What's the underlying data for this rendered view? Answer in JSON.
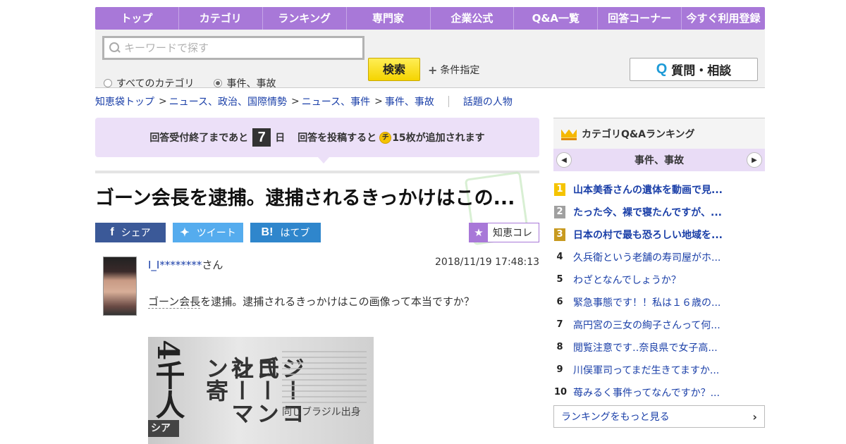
{
  "nav": [
    "トップ",
    "カテゴリ",
    "ランキング",
    "専門家",
    "企業公式",
    "Q&A一覧",
    "回答コーナー",
    "今すぐ利用登録"
  ],
  "search": {
    "placeholder": "キーワードで探す",
    "button": "検索",
    "conditions": "条件指定",
    "ask_button": "質問・相談",
    "ask_icon": "Q",
    "radio_all": "すべてのカテゴリ",
    "radio_current": "事件、事故"
  },
  "breadcrumb": {
    "items": [
      "知恵袋トップ",
      "ニュース、政治、国際情勢",
      "ニュース、事件",
      "事件、事故"
    ],
    "sep": ">",
    "related": "話題の人物"
  },
  "notice": {
    "prefix": "回答受付終了まであと",
    "days": "7",
    "unit": "日",
    "suffix": "回答を投稿すると",
    "coin_label": "チ",
    "bonus": "15枚が追加されます"
  },
  "question": {
    "title": "ゴーン会長を逮捕。逮捕されるきっかけはこの...",
    "user": "I_I********",
    "honorific": "さん",
    "date": "2018/11/19  17:48:13",
    "keyword": "ゴーン会長",
    "body_rest": "を逮捕。逮捕されるきっかけはこの画像って本当ですか？",
    "image": {
      "big": "4千人",
      "col1": "ジーコ氏",
      "col2": "ゴーン社",
      "col3": "シーマン寄",
      "caption": "同じブラジル出身",
      "tag": "シア"
    }
  },
  "share": {
    "facebook": "シェア",
    "twitter": "ツイート",
    "hatena": "はてブ",
    "hatena_icon": "B!",
    "chiekore": "知恵コレ"
  },
  "sidebar": {
    "title": "カテゴリQ&Aランキング",
    "category": "事件、事故",
    "ranking": [
      {
        "n": "1",
        "t": "山本美香さんの遺体を動画で見..."
      },
      {
        "n": "2",
        "t": "たった今、裸で寝たんですが、..."
      },
      {
        "n": "3",
        "t": "日本の村で最も恐ろしい地域を..."
      },
      {
        "n": "4",
        "t": "久兵衛という老舗の寿司屋がホ..."
      },
      {
        "n": "5",
        "t": "わざとなんでしょうか？"
      },
      {
        "n": "6",
        "t": "緊急事態です！！私は１６歳の..."
      },
      {
        "n": "7",
        "t": "高円宮の三女の絢子さんって何..."
      },
      {
        "n": "8",
        "t": "閲覧注意です‥奈良県で女子高..."
      },
      {
        "n": "9",
        "t": "川俣軍司ってまだ生きてますか..."
      },
      {
        "n": "10",
        "t": "苺みるく事件ってなんですか？..."
      }
    ],
    "more": "ランキングをもっと見る"
  }
}
